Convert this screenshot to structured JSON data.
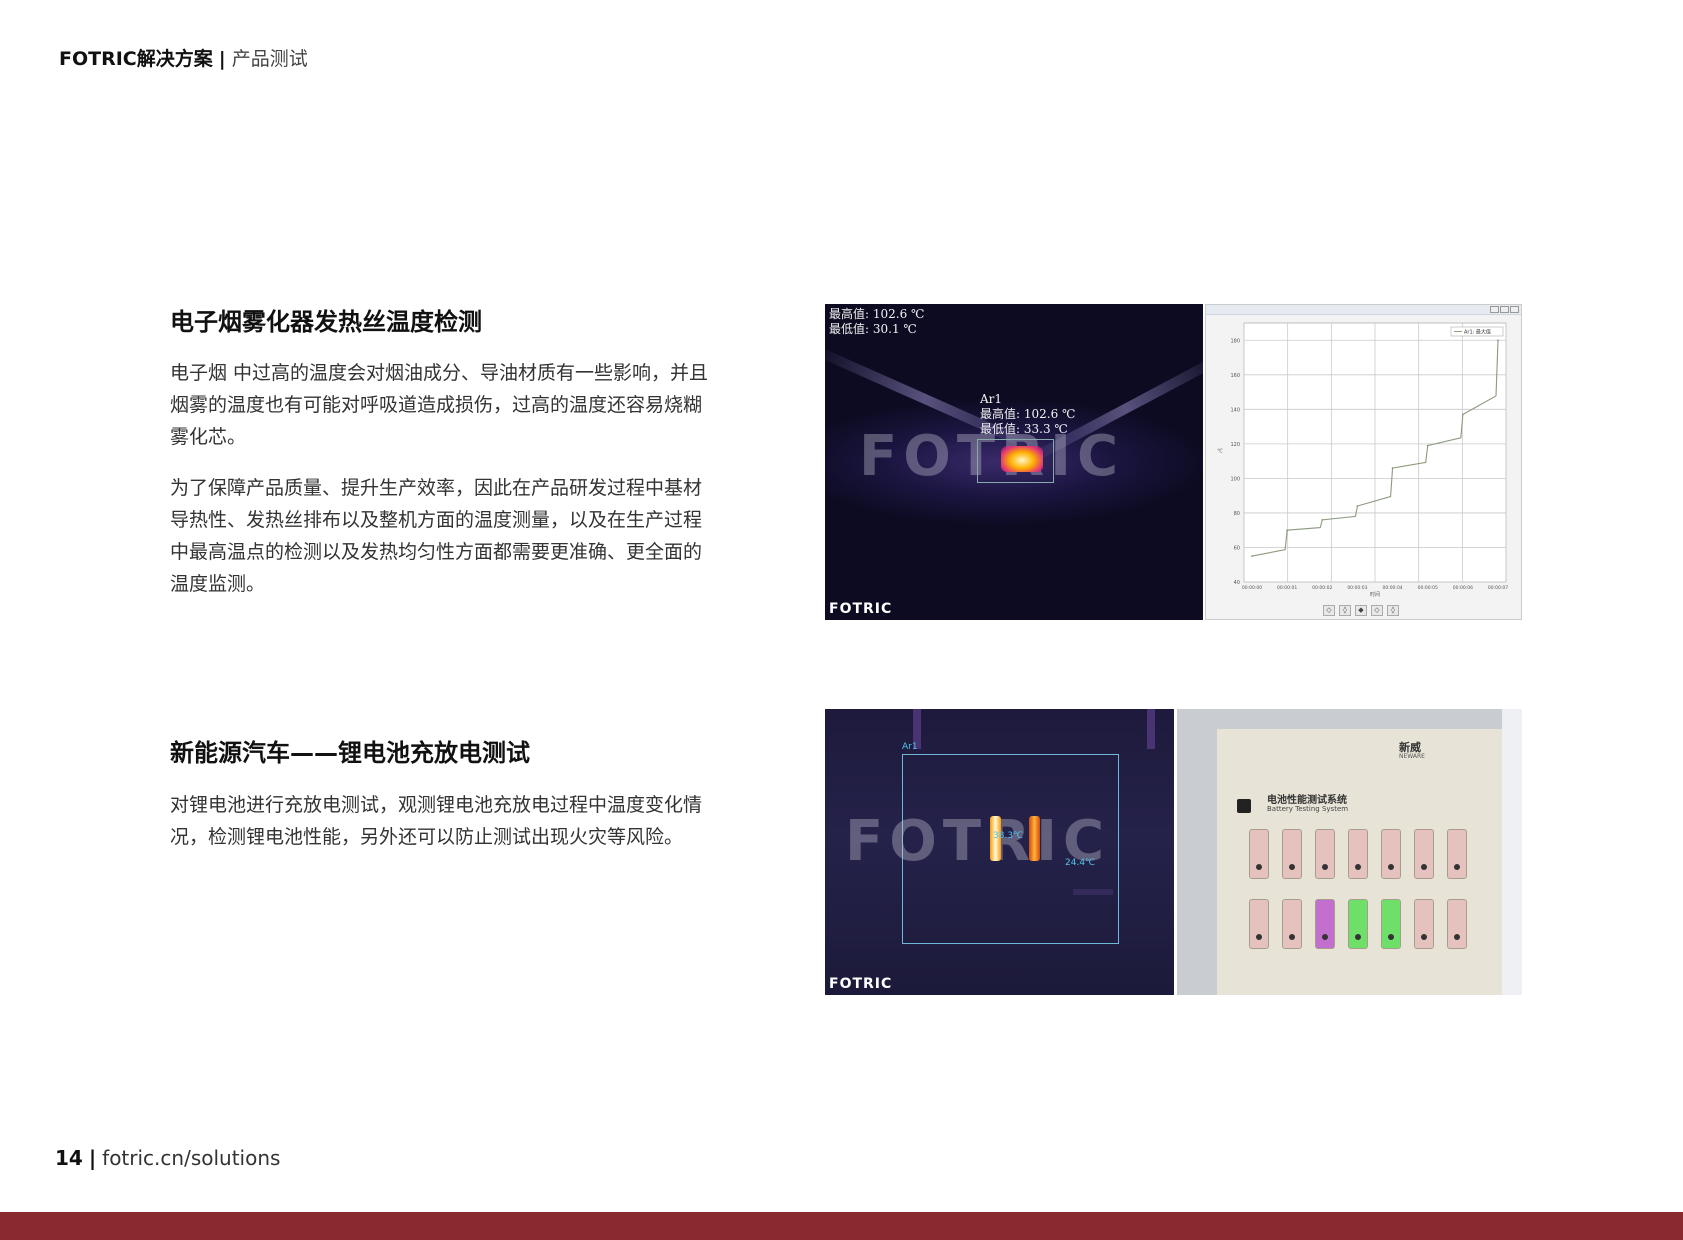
{
  "header": {
    "brand": "FOTRIC解决方案",
    "separator": "|",
    "section": "产品测试"
  },
  "sections": [
    {
      "title": "电子烟雾化器发热丝温度检测",
      "paragraphs": [
        "电子烟 中过高的温度会对烟油成分、导油材质有一些影响，并且烟雾的温度也有可能对呼吸道造成损伤，过高的温度还容易烧糊雾化芯。",
        "为了保障产品质量、提升生产效率，因此在产品研发过程中基材导热性、发热丝排布以及整机方面的温度测量，以及在生产过程中最高温点的检测以及发热均匀性方面都需要更准确、更全面的温度监测。"
      ]
    },
    {
      "title": "新能源汽车——锂电池充放电测试",
      "paragraphs": [
        "对锂电池进行充放电测试，观测锂电池充放电过程中温度变化情况，检测锂电池性能，另外还可以防止测试出现火灾等风险。"
      ]
    }
  ],
  "thermal_1": {
    "max_line": "最高值: 102.6 ℃",
    "min_line": "最低值: 30.1 ℃",
    "roi_name": "Ar1",
    "roi_max": "最高值: 102.6 ℃",
    "roi_min": "最低值: 33.3 ℃",
    "watermark": "FOTRIC",
    "logo": "FOTRIC"
  },
  "chart_data": {
    "type": "line",
    "title": "",
    "xlabel": "时间",
    "ylabel": "℃",
    "legend": "Ar1: 最大值",
    "x": [
      "00:00:00",
      "00:00:01",
      "00:00:02",
      "00:00:03",
      "00:00:04",
      "00:00:05",
      "00:00:06",
      "00:00:07"
    ],
    "series": [
      {
        "name": "Ar1: 最大值",
        "values": [
          55,
          70,
          76,
          84,
          106,
          119,
          137,
          180
        ]
      }
    ],
    "y_ticks": [
      40,
      60,
      80,
      100,
      120,
      140,
      160,
      180
    ],
    "ylim": [
      40,
      190
    ],
    "grid": true,
    "color": "#8c9a7e"
  },
  "thermal_2": {
    "roi_name": "Ar1",
    "label_hot": "38.3℃",
    "label_cold": "24.4℃",
    "watermark": "FOTRIC",
    "logo": "FOTRIC"
  },
  "photo_2": {
    "brand": "新威",
    "brand_en": "NEWARE",
    "panel_title": "电池性能测试系统",
    "panel_subtitle": "Battery Testing System"
  },
  "footer": {
    "page": "14",
    "separator": "|",
    "url": "fotric.cn/solutions"
  },
  "colors": {
    "band": "#8b2a2e"
  }
}
